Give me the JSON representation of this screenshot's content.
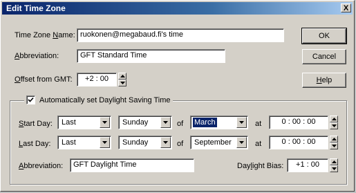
{
  "window": {
    "title": "Edit Time Zone",
    "close_glyph": "X"
  },
  "fields": {
    "tz_name_label_pre": "Time Zone ",
    "tz_name_label_key": "N",
    "tz_name_label_post": "ame:",
    "tz_name_value": "ruokonen@megabaud.fi's time",
    "abbrev_label_key": "A",
    "abbrev_label_post": "bbreviation:",
    "abbrev_value": "GFT Standard Time",
    "offset_label_key": "O",
    "offset_label_post": "ffset from GMT:",
    "offset_value": "+2 : 00"
  },
  "buttons": {
    "ok": "OK",
    "cancel": "Cancel",
    "help_key": "H",
    "help_post": "elp"
  },
  "dst": {
    "checkbox_checked": true,
    "checkbox_label": "Automatically set Daylight Saving Time",
    "start_label_key": "S",
    "start_label_post": "tart Day:",
    "start_week": "Last",
    "start_weekday": "Sunday",
    "of1": "of",
    "start_month": "March",
    "at1": "at",
    "start_time": "0 : 00 : 00",
    "last_label_pre": "L",
    "last_label_post": "ast Day:",
    "last_week": "Last",
    "last_weekday": "Sunday",
    "of2": "of",
    "last_month": "September",
    "at2": "at",
    "last_time": "0 : 00 : 00",
    "abbrev_label_key": "A",
    "abbrev_label_post": "bbreviation:",
    "abbrev_value": "GFT Daylight Time",
    "bias_label_pre": "Day",
    "bias_label_key": "l",
    "bias_label_post": "ight Bias:",
    "bias_value": "+1 : 00"
  }
}
